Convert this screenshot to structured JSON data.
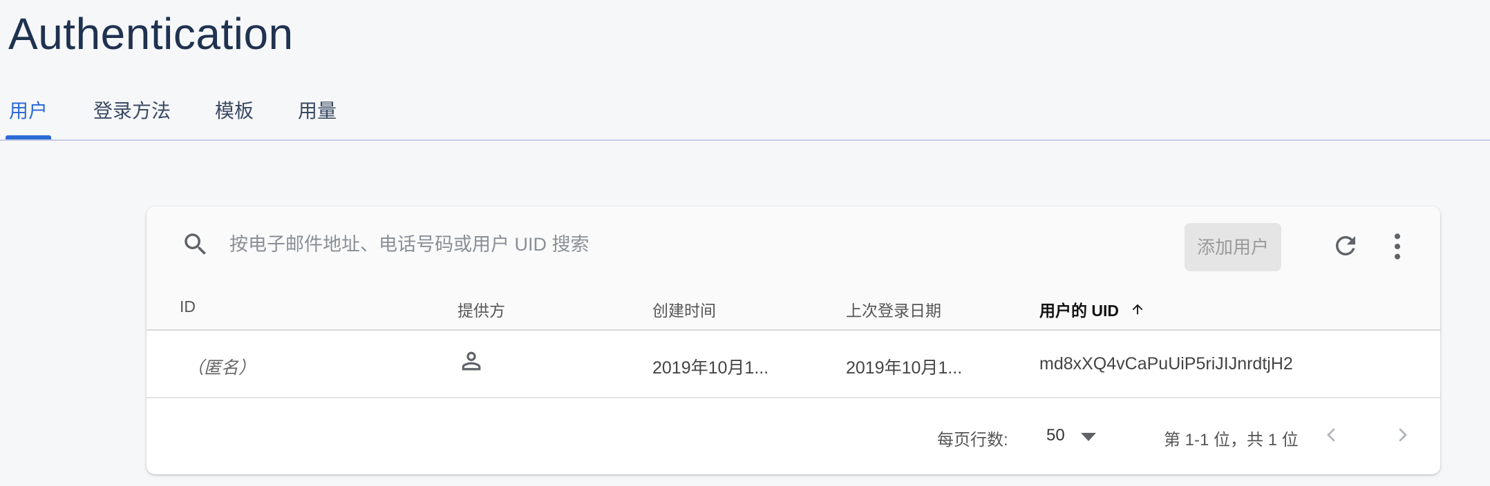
{
  "page": {
    "title": "Authentication"
  },
  "tabs": [
    {
      "label": "用户",
      "active": true
    },
    {
      "label": "登录方法",
      "active": false
    },
    {
      "label": "模板",
      "active": false
    },
    {
      "label": "用量",
      "active": false
    }
  ],
  "colors": {
    "accent": "#2d6bd6",
    "title": "#1f3250",
    "background": "#f6f7f9"
  },
  "toolbar": {
    "search_icon": "search-icon",
    "search_placeholder": "按电子邮件地址、电话号码或用户 UID 搜索",
    "search_value": "",
    "add_user_label": "添加用户",
    "refresh_icon": "refresh-icon",
    "more_icon": "more-vert-icon"
  },
  "table": {
    "columns": [
      {
        "label": "ID"
      },
      {
        "label": "提供方"
      },
      {
        "label": "创建时间"
      },
      {
        "label": "上次登录日期"
      },
      {
        "label": "用户的 UID",
        "sorted": "ascending",
        "sort_icon": "arrow-up-icon"
      }
    ],
    "rows": [
      {
        "id": "（匿名）",
        "provider_icon": "person-icon",
        "created": "2019年10月1...",
        "last_signin": "2019年10月1...",
        "uid": "md8xXQ4vCaPuUiP5riJIJnrdtjH2"
      }
    ]
  },
  "pagination": {
    "rows_per_page_label": "每页行数:",
    "rows_per_page_value": "50",
    "range_label": "第 1-1 位，共 1 位",
    "prev_icon": "chevron-left-icon",
    "next_icon": "chevron-right-icon"
  }
}
